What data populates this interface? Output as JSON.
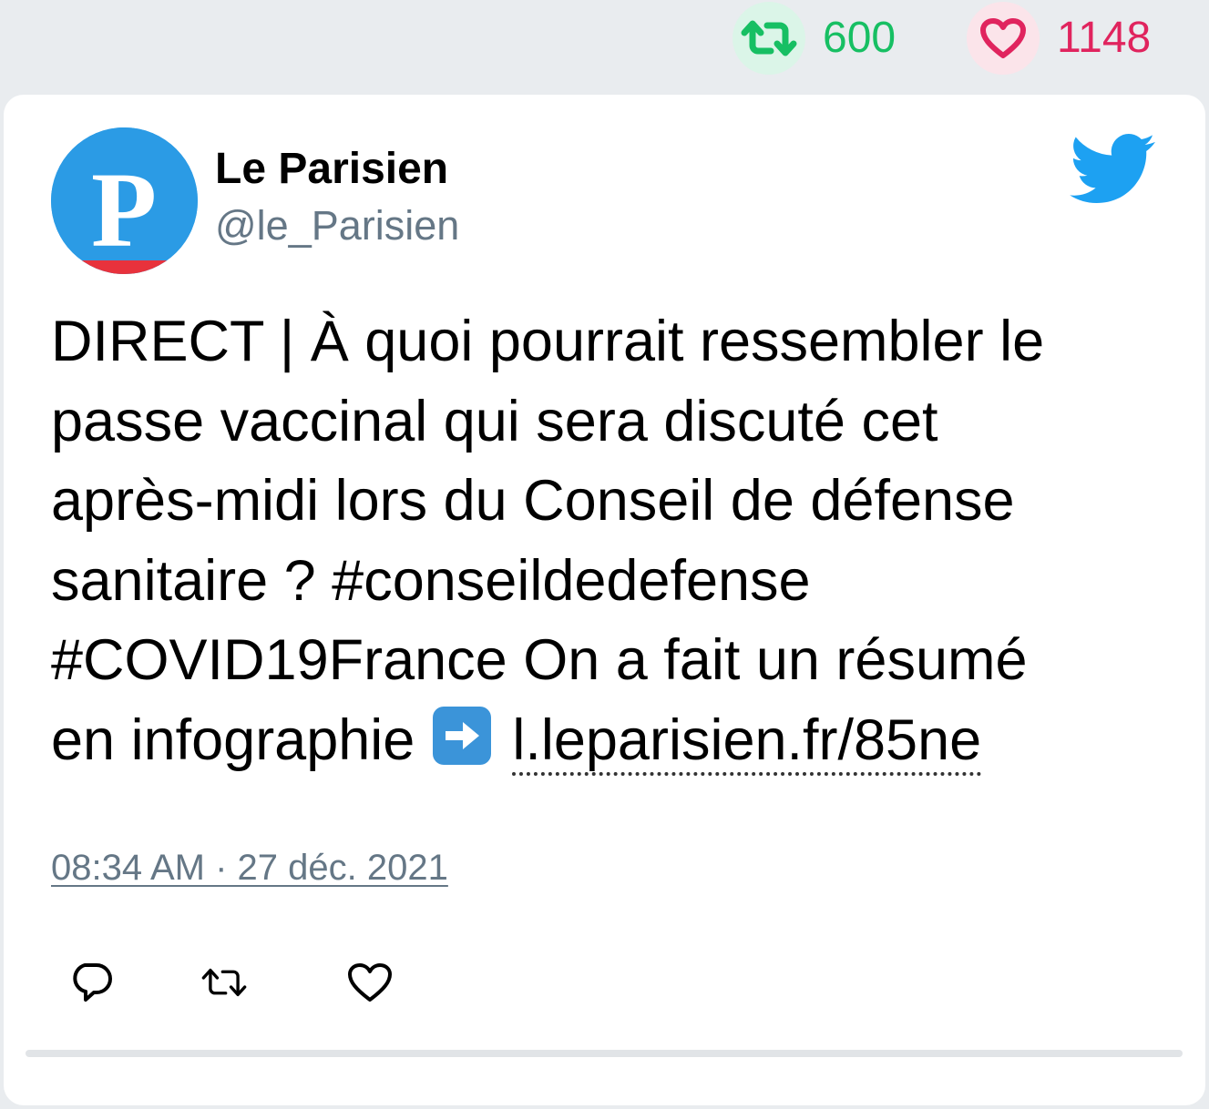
{
  "stats": {
    "retweet_count": "600",
    "like_count": "1148",
    "retweet_color": "#17bf63",
    "like_color": "#e0245e"
  },
  "tweet": {
    "author_name": "Le Parisien",
    "author_handle": "@le_Parisien",
    "avatar_letter": "P",
    "text_line_1": "DIRECT | À quoi pourrait ressembler le",
    "text_line_2": "passe vaccinal qui sera discuté cet",
    "text_line_3": "après-midi lors du Conseil de défense",
    "text_line_4": "sanitaire ? #conseildedefense",
    "text_line_5": "#COVID19France On a fait un résumé",
    "text_line_6": "en infographie",
    "arrow_emoji": "right-arrow-emoji",
    "link_text": "l.leparisien.fr/85ne",
    "timestamp": "08:34 AM · 27 déc. 2021"
  },
  "icons": {
    "brand": "twitter-bird-icon",
    "reply": "reply-icon",
    "retweet": "retweet-icon",
    "like": "heart-icon"
  },
  "colors": {
    "twitter_blue": "#1da1f2",
    "handle_gray": "#657786",
    "avatar_blue": "#2b9be5",
    "avatar_red": "#e8323c"
  }
}
